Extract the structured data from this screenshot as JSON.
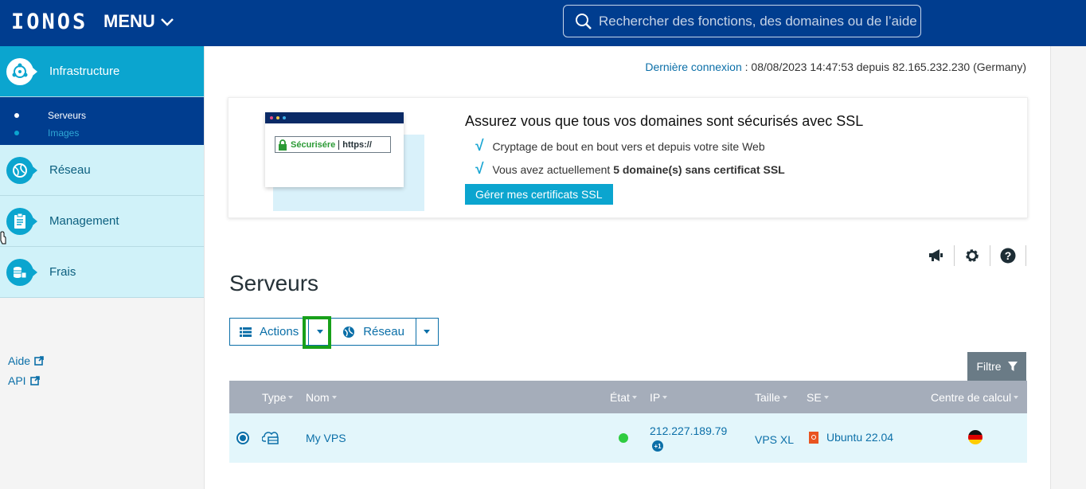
{
  "header": {
    "logo": "IONOS",
    "menu_label": "MENU",
    "search_placeholder": "Rechercher des fonctions, des domaines ou de l’aide"
  },
  "sidebar": {
    "items": [
      {
        "label": "Infrastructure",
        "icon": "infrastructure-icon",
        "active": true
      },
      {
        "label": "Réseau",
        "icon": "network-globe-icon"
      },
      {
        "label": "Management",
        "icon": "clipboard-icon"
      },
      {
        "label": "Frais",
        "icon": "coins-icon"
      }
    ],
    "subitems": [
      {
        "label": "Serveurs",
        "active": true
      },
      {
        "label": "Images",
        "active": false
      }
    ],
    "links": [
      {
        "label": "Aide",
        "icon": "external-link-icon"
      },
      {
        "label": "API",
        "icon": "external-link-icon"
      }
    ]
  },
  "last_login": {
    "label": "Dernière connexion",
    "value": " : 08/08/2023 14:47:53 depuis 82.165.232.230 (Germany)"
  },
  "promo": {
    "art_secure": "Sécurisére",
    "art_https": "https://",
    "title": "Assurez vous que tous vos domaines sont sécurisés avec SSL",
    "item1": "Cryptage de bout en bout vers et depuis votre site Web",
    "item2_prefix": "Vous avez actuellement ",
    "item2_bold": "5 domaine(s) sans certificat SSL",
    "button": "Gérer mes certificats SSL"
  },
  "tools": [
    "megaphone-icon",
    "gear-icon",
    "help-icon"
  ],
  "page_title": "Serveurs",
  "toolbar": {
    "actions_label": "Actions",
    "reseau_label": "Réseau",
    "filter_label": "Filtre"
  },
  "table": {
    "headers": {
      "type": "Type",
      "nom": "Nom",
      "etat": "État",
      "ip": "IP",
      "taille": "Taille",
      "se": "SE",
      "centre": "Centre de calcul"
    },
    "rows": [
      {
        "selected": true,
        "type_icon": "cloud-server-icon",
        "nom": "My VPS",
        "etat": "running",
        "ip": "212.227.189.79",
        "ip_extra": "+1",
        "taille": "VPS XL",
        "se": "Ubuntu 22.04",
        "centre_flag": "germany-flag-icon"
      }
    ]
  },
  "colors": {
    "header_bg": "#003d8f",
    "accent": "#0ba5cf",
    "link": "#0b6fa8",
    "highlight_box": "#18a01a",
    "status_running": "#2ecc40"
  }
}
